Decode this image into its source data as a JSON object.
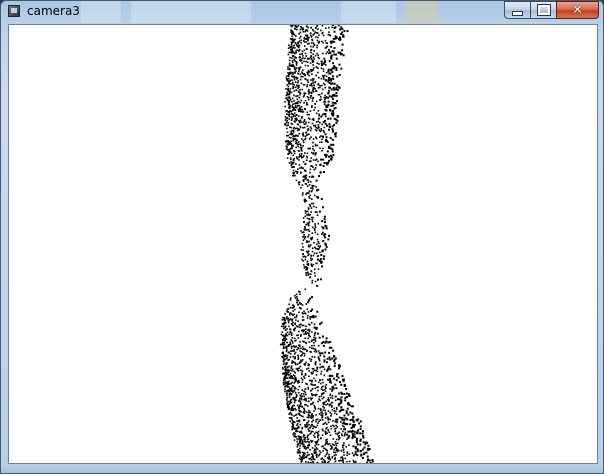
{
  "window": {
    "title": "camera3",
    "icon": "app-window-icon",
    "controls": {
      "minimize_icon": "minimize-icon",
      "maximize_icon": "maximize-icon",
      "close_icon": "close-icon",
      "close_glyph": "✕"
    }
  },
  "viewport": {
    "content": "point-cloud",
    "background_color": "#ffffff",
    "point_color": "#000000"
  },
  "colors": {
    "frame": "#b7cfe7",
    "close_button": "#c7462a"
  }
}
